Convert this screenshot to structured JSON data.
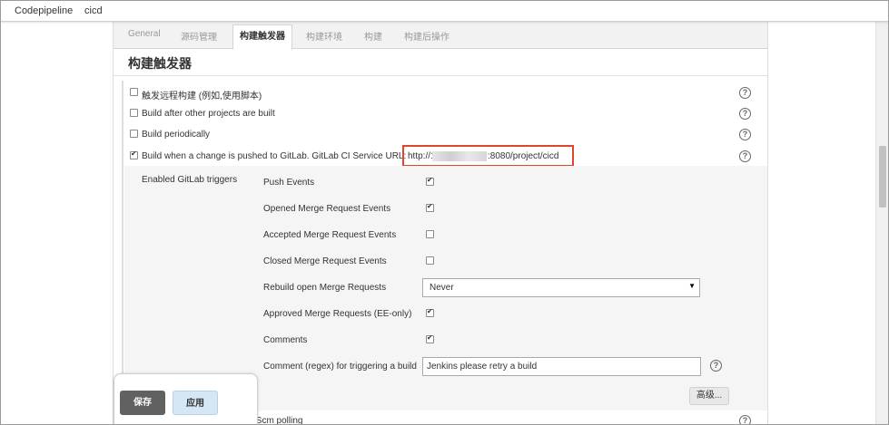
{
  "breadcrumb": [
    "Codepipeline",
    "cicd"
  ],
  "tabs": [
    "General",
    "源码管理",
    "构建触发器",
    "构建环境",
    "构建",
    "构建后操作"
  ],
  "active_tab": "构建触发器",
  "section_title": "构建触发器",
  "triggers": [
    {
      "label": "触发远程构建 (例如,使用脚本)",
      "checked": false
    },
    {
      "label": "Build after other projects are built",
      "checked": false
    },
    {
      "label": "Build periodically",
      "checked": false
    },
    {
      "label": "Build when a change is pushed to GitLab. GitLab CI Service URL:",
      "checked": true
    }
  ],
  "service_url_prefix": "http://19",
  "service_url_suffix": ":8080/project/cicd",
  "gitlab_triggers_label": "Enabled GitLab triggers",
  "gitlab_options": [
    {
      "label": "Push Events",
      "checked": true
    },
    {
      "label": "Opened Merge Request Events",
      "checked": true
    },
    {
      "label": "Accepted Merge Request Events",
      "checked": false
    },
    {
      "label": "Closed Merge Request Events",
      "checked": false
    }
  ],
  "rebuild_label": "Rebuild open Merge Requests",
  "rebuild_value": "Never",
  "approved_label": "Approved Merge Requests (EE-only)",
  "approved_checked": true,
  "comments_label": "Comments",
  "comments_checked": true,
  "comment_regex_label": "Comment (regex) for triggering a build",
  "comment_regex_value": "Jenkins please retry a build",
  "advanced_label": "高级...",
  "partial_row_label": "r GITScm polling",
  "save_label": "保存",
  "apply_label": "应用",
  "colors": {
    "highlight_box": "#e0462f",
    "save_button": "#616161",
    "apply_button": "#d5e6f5"
  }
}
